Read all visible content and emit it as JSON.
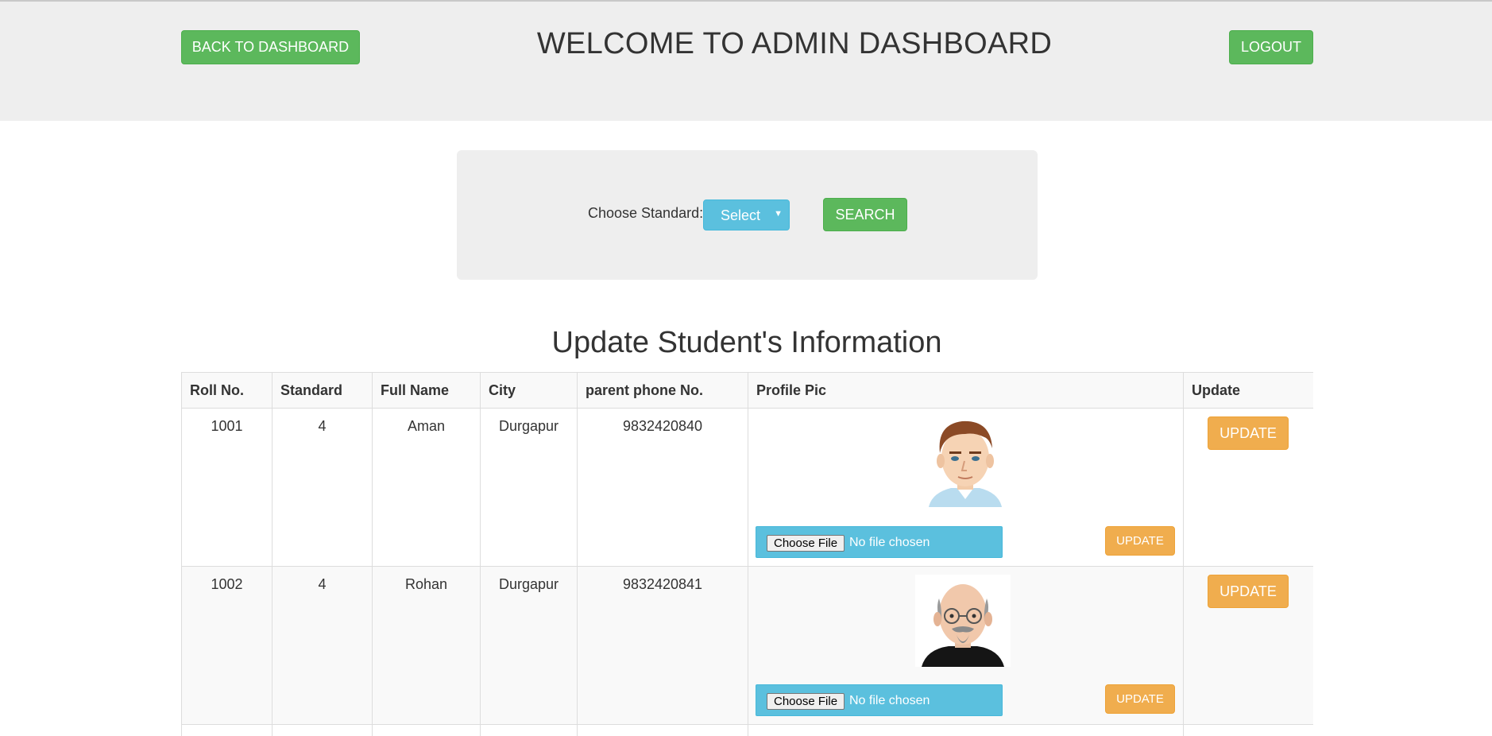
{
  "header": {
    "back_label": "BACK TO DASHBOARD",
    "title": "WELCOME TO ADMIN DASHBOARD",
    "logout_label": "LOGOUT"
  },
  "search": {
    "label": "Choose Standard:",
    "select_value": "Select",
    "button_label": "SEARCH"
  },
  "section_title": "Update Student's Information",
  "table": {
    "headers": [
      "Roll No.",
      "Standard",
      "Full Name",
      "City",
      "parent phone No.",
      "Profile Pic",
      "Update"
    ],
    "rows": [
      {
        "roll": "1001",
        "standard": "4",
        "name": "Aman",
        "city": "Durgapur",
        "phone": "9832420840",
        "file_button": "Choose File",
        "file_status": "No file chosen",
        "pic_update": "UPDATE",
        "row_update": "UPDATE"
      },
      {
        "roll": "1002",
        "standard": "4",
        "name": "Rohan",
        "city": "Durgapur",
        "phone": "9832420841",
        "file_button": "Choose File",
        "file_status": "No file chosen",
        "pic_update": "UPDATE",
        "row_update": "UPDATE"
      }
    ]
  },
  "colors": {
    "green": "#5cb85c",
    "info": "#5bc0de",
    "orange": "#f0ad4e",
    "header_bg": "#eeeeee"
  }
}
